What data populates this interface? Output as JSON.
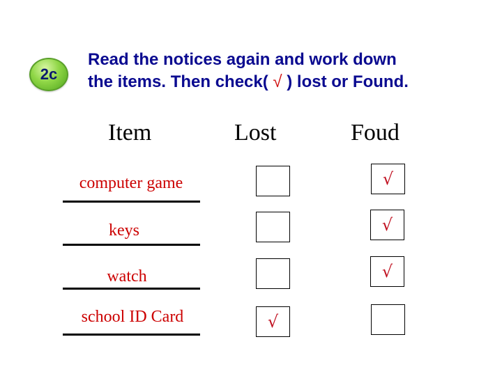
{
  "badge": {
    "label": "2c"
  },
  "instructions": {
    "line1": "Read the notices again and work down",
    "line2_pre": "the items. Then check(",
    "check_mark": "√",
    "line2_post": ") lost or Found."
  },
  "table": {
    "headers": {
      "item": "Item",
      "lost": "Lost",
      "found": "Foud"
    },
    "rows": [
      {
        "item": "computer game",
        "lost": "",
        "found": "√"
      },
      {
        "item": "keys",
        "lost": "",
        "found": "√"
      },
      {
        "item": "watch",
        "lost": "",
        "found": "√"
      },
      {
        "item": "school ID Card",
        "lost": "√",
        "found": ""
      }
    ]
  }
}
